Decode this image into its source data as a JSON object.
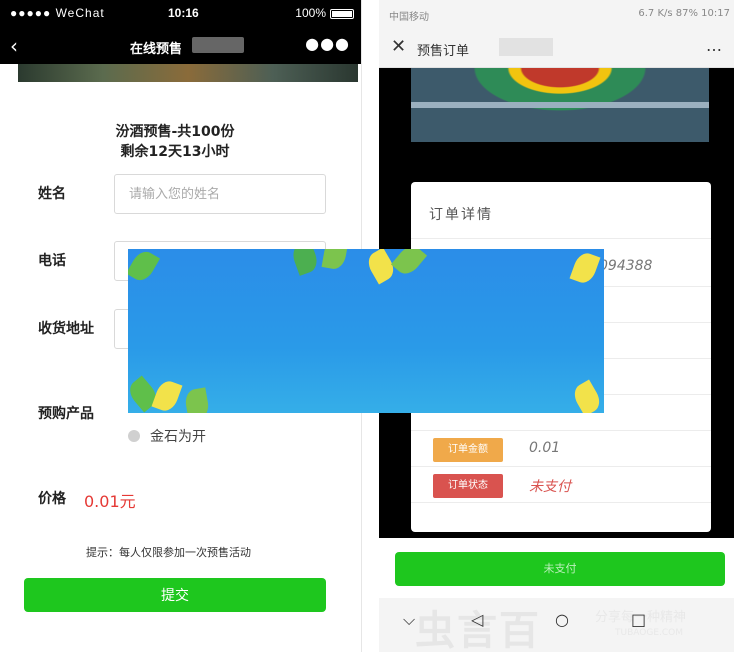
{
  "left_phone": {
    "status_bar": {
      "carrier": "●●●●● WeChat",
      "time": "10:16",
      "battery": "100%"
    },
    "nav": {
      "back_icon": "chevron-left-icon",
      "title": "在线预售",
      "more_icon": "more-dots-icon"
    },
    "product": {
      "title": "汾酒预售-共100份",
      "remaining": "剩余12天13小时"
    },
    "form": {
      "name_label": "姓名",
      "name_placeholder": "请输入您的姓名",
      "phone_label": "电话",
      "address_label": "收货地址",
      "product_label": "预购产品",
      "product_option": "金石为开",
      "price_label": "价格",
      "price_value": "0.01元",
      "tip": "提示：每人仅限参加一次预售活动",
      "submit_label": "提交"
    }
  },
  "right_phone": {
    "status_bar": {
      "carrier": "中国移动",
      "right": "6.7 K/s  87%  10:17"
    },
    "nav": {
      "close_icon": "close-icon",
      "title": "预售订单",
      "more_icon": "more-dots-icon"
    },
    "card": {
      "title": "订单详情",
      "number_fragment": "094388",
      "rows": [
        {
          "tag": "订单金额",
          "value": "0.01",
          "tag_color": "#f0a94a",
          "value_color": "#777777"
        },
        {
          "tag": "订单状态",
          "value": "未支付",
          "tag_color": "#d9534f",
          "value_color": "#d9534f"
        }
      ]
    },
    "pay_button": "未支付",
    "bottom_nav": {
      "back": "⌵",
      "home": "◁",
      "recent": "○",
      "square": "□"
    },
    "watermark": {
      "big": "虫言百",
      "small": "分享每一种精神",
      "url": "TUBAOGE.COM"
    }
  },
  "overlay": {
    "color": "#2b8de8"
  }
}
